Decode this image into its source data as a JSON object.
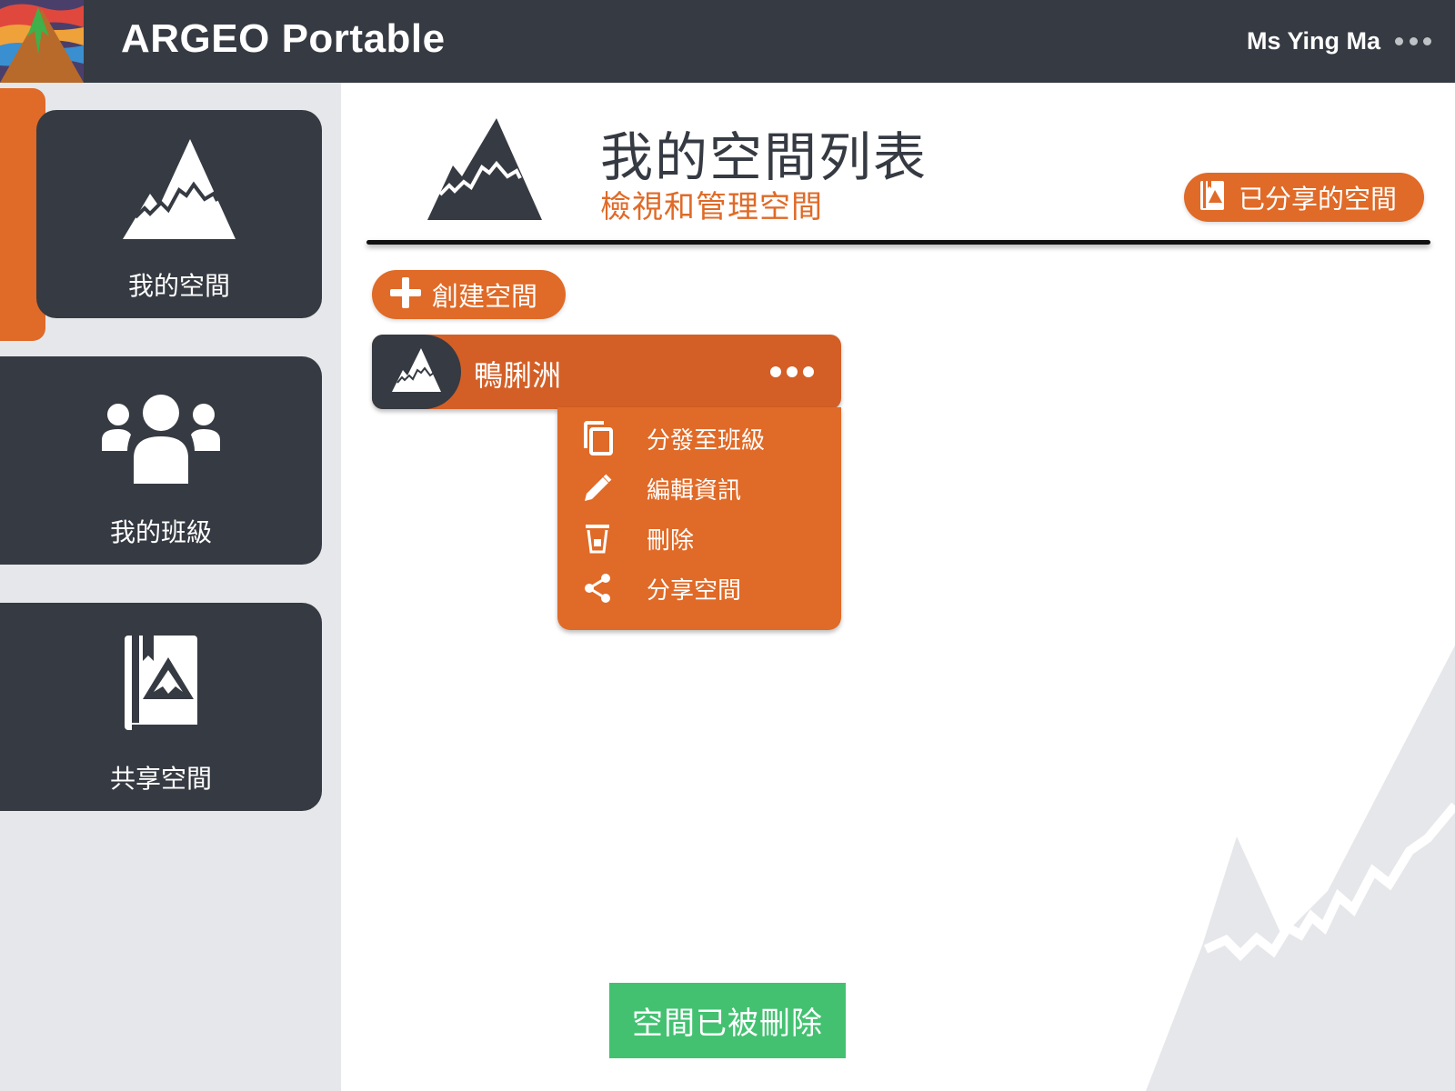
{
  "app": {
    "title": "ARGEO Portable",
    "user_name": "Ms Ying Ma",
    "user_menu_icon": "more-horizontal-icon"
  },
  "sidebar": {
    "items": [
      {
        "label": "我的空間",
        "icon": "mountain-icon",
        "active": true
      },
      {
        "label": "我的班級",
        "icon": "users-icon",
        "active": false
      },
      {
        "label": "共享空間",
        "icon": "shared-book-icon",
        "active": false
      }
    ]
  },
  "header": {
    "title": "我的空間列表",
    "subtitle": "檢視和管理空間",
    "shared_button_label": "已分享的空間"
  },
  "actions": {
    "create_label": "創建空間"
  },
  "spaces": [
    {
      "name": "鴨脷洲"
    }
  ],
  "dropdown": {
    "items": [
      {
        "label": "分發至班級",
        "icon": "copy-icon"
      },
      {
        "label": "編輯資訊",
        "icon": "pencil-icon"
      },
      {
        "label": "刪除",
        "icon": "trash-icon"
      },
      {
        "label": "分享空間",
        "icon": "share-icon"
      }
    ]
  },
  "toast": {
    "message": "空間已被刪除"
  },
  "colors": {
    "accent": "#e06a27",
    "dark": "#363a42",
    "success": "#43c171",
    "sidebar_bg": "#e6e7ea"
  }
}
